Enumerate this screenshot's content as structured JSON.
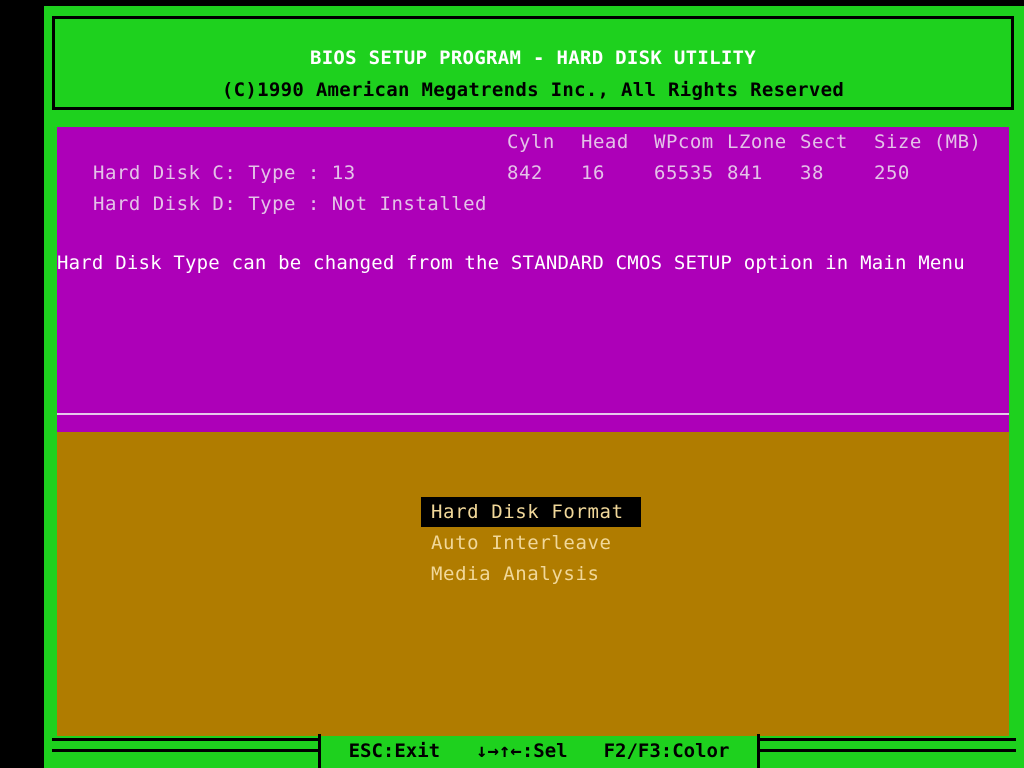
{
  "header": {
    "title": "BIOS SETUP PROGRAM - HARD DISK UTILITY",
    "copyright": "(C)1990 American Megatrends Inc., All Rights Reserved"
  },
  "disk_table": {
    "columns": [
      "Cyln",
      "Head",
      "WPcom",
      "LZone",
      "Sect",
      "Size (MB)"
    ],
    "disk_c": {
      "label": "Hard Disk C: Type : 13",
      "values": [
        "842",
        "16",
        "65535",
        "841",
        "38",
        "250"
      ]
    },
    "disk_d": {
      "label": "Hard Disk D: Type : Not Installed"
    }
  },
  "note": "Hard Disk Type can be changed from the STANDARD CMOS SETUP option in Main Menu",
  "menu": {
    "items": [
      "Hard Disk Format",
      "Auto Interleave",
      "Media Analysis"
    ],
    "selected": "Hard Disk Format"
  },
  "footer": {
    "exit": "ESC:Exit",
    "select": "↓→↑←:Sel",
    "color": "F2/F3:Color"
  },
  "colors": {
    "screen": "#1ed11e",
    "info_panel": "#ad00b8",
    "menu_panel": "#b07c00",
    "menu_text": "#f1d89a",
    "selection": "#000000"
  }
}
